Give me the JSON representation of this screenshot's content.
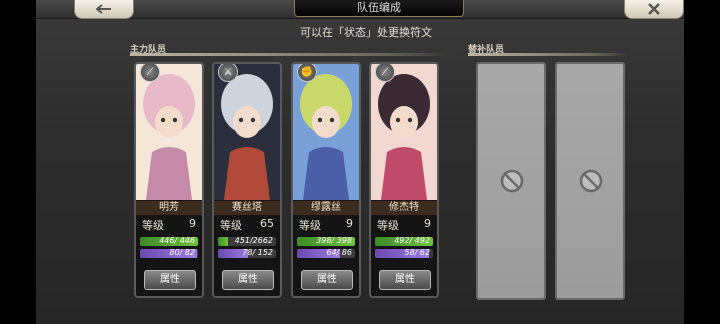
{
  "header": {
    "title": "队伍编成",
    "hint": "可以在「状态」处更换符文"
  },
  "sections": {
    "main_label": "主力队员",
    "reserve_label": "替补队员"
  },
  "cards": [
    {
      "name": "明芳",
      "level_label": "等级",
      "level": "9",
      "hp": "446/ 446",
      "hp_ratio": 1.0,
      "mp": "80/ 82",
      "mp_ratio": 0.976,
      "attr_label": "属性",
      "element_icon": "spear-icon",
      "palette": [
        "#e8b9c9",
        "#c48aa8",
        "#f4e6d8"
      ]
    },
    {
      "name": "赛丝塔",
      "level_label": "等级",
      "level": "65",
      "hp": "451/2662",
      "hp_ratio": 0.169,
      "mp": "78/ 152",
      "mp_ratio": 0.513,
      "attr_label": "属性",
      "element_icon": "sword-icon",
      "palette": [
        "#cfd3dc",
        "#b14a3a",
        "#2b2f3c"
      ]
    },
    {
      "name": "缪露丝",
      "level_label": "等级",
      "level": "9",
      "hp": "398/ 398",
      "hp_ratio": 1.0,
      "mp": "64/ 86",
      "mp_ratio": 0.744,
      "attr_label": "属性",
      "element_icon": "fist-icon",
      "palette": [
        "#c9d86a",
        "#4b5ea8",
        "#7aa0d8"
      ]
    },
    {
      "name": "修杰特",
      "level_label": "等级",
      "level": "9",
      "hp": "492/ 492",
      "hp_ratio": 1.0,
      "mp": "58/ 62",
      "mp_ratio": 0.935,
      "attr_label": "属性",
      "element_icon": "staff-icon",
      "palette": [
        "#3a2a34",
        "#c04a6a",
        "#f2d8d0"
      ]
    }
  ],
  "reserve_slots": [
    {
      "state": "empty"
    },
    {
      "state": "empty"
    }
  ]
}
